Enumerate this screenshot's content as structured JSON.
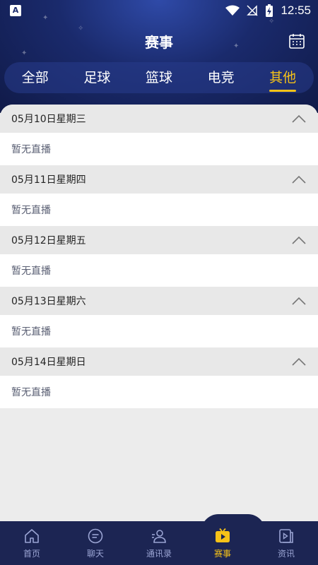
{
  "status_bar": {
    "time": "12:55",
    "app_icon": "A",
    "icons": [
      "wifi-icon",
      "signal-off-icon",
      "battery-charging-icon"
    ]
  },
  "header": {
    "title": "赛事",
    "right_icon": "calendar-icon"
  },
  "tabs": [
    {
      "label": "全部",
      "active": false
    },
    {
      "label": "足球",
      "active": false
    },
    {
      "label": "篮球",
      "active": false
    },
    {
      "label": "电竞",
      "active": false
    },
    {
      "label": "其他",
      "active": true
    }
  ],
  "days": [
    {
      "date": "05月10日星期三",
      "message": "暂无直播"
    },
    {
      "date": "05月11日星期四",
      "message": "暂无直播"
    },
    {
      "date": "05月12日星期五",
      "message": "暂无直播"
    },
    {
      "date": "05月13日星期六",
      "message": "暂无直播"
    },
    {
      "date": "05月14日星期日",
      "message": "暂无直播"
    }
  ],
  "bottom_nav": [
    {
      "label": "首页",
      "icon": "home-icon",
      "active": false
    },
    {
      "label": "聊天",
      "icon": "chat-icon",
      "active": false
    },
    {
      "label": "通讯录",
      "icon": "contacts-icon",
      "active": false
    },
    {
      "label": "赛事",
      "icon": "play-tv-icon",
      "active": true
    },
    {
      "label": "资讯",
      "icon": "news-video-icon",
      "active": false
    }
  ],
  "colors": {
    "header_bg": "#1a2a6c",
    "accent": "#f6c218",
    "nav_bg": "#1c2553",
    "nav_inactive": "#9aa4d3"
  }
}
